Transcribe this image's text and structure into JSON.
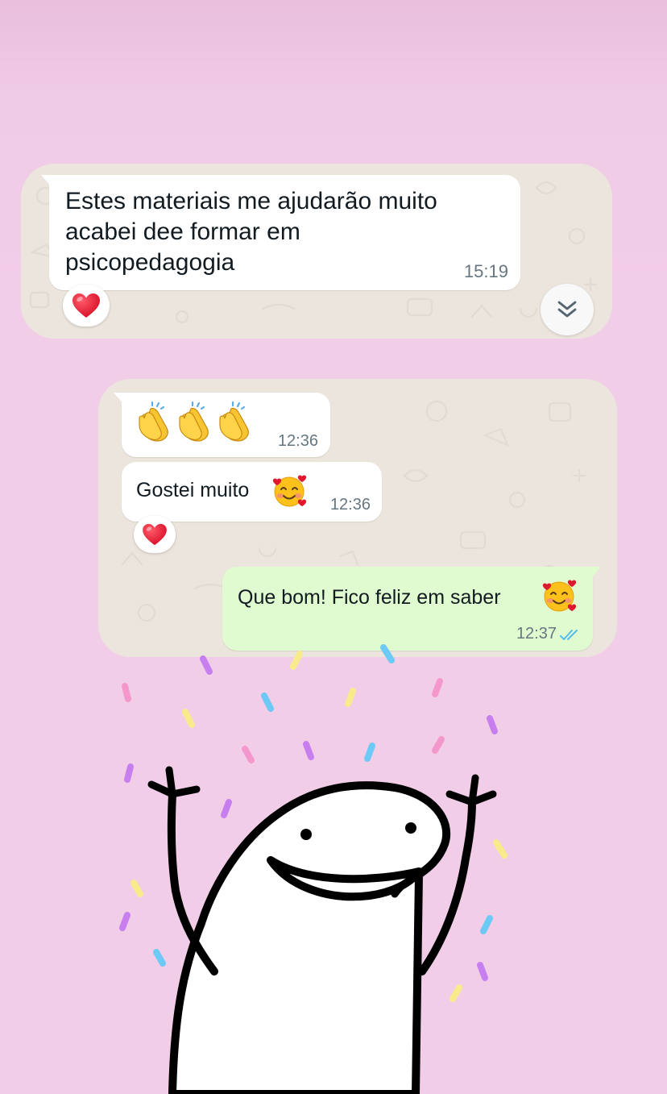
{
  "messages": [
    {
      "direction": "incoming",
      "text": "Estes materiais me ajudarão muito\nacabei dee formar em\npsicopedagogia",
      "time": "15:19",
      "reaction": "heart"
    },
    {
      "direction": "incoming",
      "text": "👏👏👏",
      "time": "12:36"
    },
    {
      "direction": "incoming",
      "text": "Gostei muito",
      "emoji": "smiling-face-with-hearts",
      "time": "12:36",
      "reaction": "heart"
    },
    {
      "direction": "outgoing",
      "text": "Que bom! Fico feliz em saber",
      "emoji": "smiling-face-with-hearts",
      "time": "12:37",
      "status": "read"
    }
  ],
  "icons": {
    "scroll_down": "double-chevron-down-icon",
    "reaction": "heart-icon",
    "read_receipt": "double-check-icon"
  },
  "colors": {
    "background": "#f2cde8",
    "chat_wallpaper": "#ece5dd",
    "incoming_bubble": "#ffffff",
    "outgoing_bubble": "#e1fbd0",
    "read_ticks": "#53bdeb",
    "heart": "#e0182d"
  }
}
